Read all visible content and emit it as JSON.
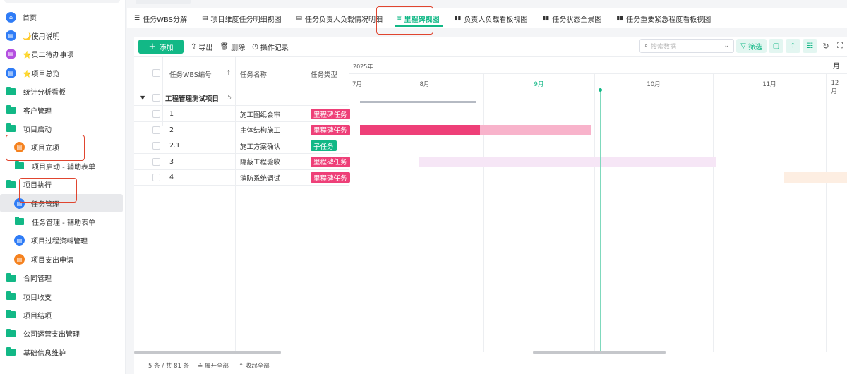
{
  "sidebar": {
    "items": [
      {
        "label": "首页",
        "icon": "home-icon",
        "kind": "circle",
        "color": "#2f7cf6"
      },
      {
        "label": "🌙使用说明",
        "icon": "document-icon",
        "kind": "circle",
        "color": "#2f7cf6"
      },
      {
        "label": "⭐员工待办事项",
        "icon": "chat-icon",
        "kind": "circle",
        "color": "#b44fe0"
      },
      {
        "label": "⭐项目总览",
        "icon": "document-icon",
        "kind": "circle",
        "color": "#2f7cf6"
      },
      {
        "label": "统计分析看板",
        "icon": "folder-icon",
        "kind": "folder"
      },
      {
        "label": "客户管理",
        "icon": "folder-icon",
        "kind": "folder"
      },
      {
        "label": "项目启动",
        "icon": "folder-open-icon",
        "kind": "folder"
      },
      {
        "label": "项目立项",
        "icon": "form-icon",
        "kind": "circle",
        "color": "#f5821f",
        "sub": true
      },
      {
        "label": "项目启动 - 辅助表单",
        "icon": "folder-icon",
        "kind": "folder",
        "sub": true
      },
      {
        "label": "项目执行",
        "icon": "folder-open-icon",
        "kind": "folder"
      },
      {
        "label": "任务管理",
        "icon": "document-icon",
        "kind": "circle",
        "color": "#2f7cf6",
        "sub": true,
        "active": true
      },
      {
        "label": "任务管理 - 辅助表单",
        "icon": "folder-icon",
        "kind": "folder",
        "sub": true
      },
      {
        "label": "项目过程资料管理",
        "icon": "document-icon",
        "kind": "circle",
        "color": "#2f7cf6",
        "sub": true
      },
      {
        "label": "项目支出申请",
        "icon": "form-icon",
        "kind": "circle",
        "color": "#f5821f",
        "sub": true
      },
      {
        "label": "合同管理",
        "icon": "folder-icon",
        "kind": "folder"
      },
      {
        "label": "项目收支",
        "icon": "folder-icon",
        "kind": "folder"
      },
      {
        "label": "项目结项",
        "icon": "folder-icon",
        "kind": "folder"
      },
      {
        "label": "公司运营支出管理",
        "icon": "folder-icon",
        "kind": "folder"
      },
      {
        "label": "基础信息维护",
        "icon": "folder-icon",
        "kind": "folder"
      }
    ]
  },
  "tabs": [
    {
      "label": "任务WBS分解",
      "icon": "☰"
    },
    {
      "label": "项目维度任务明细视图",
      "icon": "▤"
    },
    {
      "label": "任务负责人负载情况明细",
      "icon": "▤"
    },
    {
      "label": "里程碑视图",
      "icon": "⩸",
      "active": true
    },
    {
      "label": "负责人负载看板视图",
      "icon": "▮▮"
    },
    {
      "label": "任务状态全景图",
      "icon": "▮▮"
    },
    {
      "label": "任务重要紧急程度看板视图",
      "icon": "▮▮"
    }
  ],
  "toolbar": {
    "add": "添加",
    "export": "导出",
    "delete": "删除",
    "log": "操作记录",
    "search_placeholder": "搜索数据",
    "filter": "筛选",
    "scale": "月"
  },
  "table": {
    "headers": {
      "wbs": "任务WBS编号",
      "name": "任务名称",
      "type": "任务类型"
    },
    "group": {
      "name": "工程管理测试项目",
      "count": "5"
    },
    "rows": [
      {
        "wbs": "1",
        "name": "施工图纸会审",
        "type": "里程碑任务",
        "type_color": "#ee3f78"
      },
      {
        "wbs": "2",
        "name": "主体结构施工",
        "type": "里程碑任务",
        "type_color": "#ee3f78"
      },
      {
        "wbs": "2.1",
        "name": "施工方案确认",
        "type": "子任务",
        "type_color": "#12b886"
      },
      {
        "wbs": "3",
        "name": "隐蔽工程验收",
        "type": "里程碑任务",
        "type_color": "#ee3f78"
      },
      {
        "wbs": "4",
        "name": "消防系统调试",
        "type": "里程碑任务",
        "type_color": "#ee3f78"
      }
    ]
  },
  "gantt": {
    "year": "2025年",
    "months": [
      "7月",
      "8月",
      "9月",
      "10月",
      "11月",
      "12月"
    ],
    "current_month": "9月",
    "bars": [
      {
        "row": "group",
        "start": [
          7,
          25
        ],
        "end": [
          8,
          30
        ],
        "color": "#b5bac3"
      },
      {
        "row": 1,
        "start": [
          7,
          25
        ],
        "end": [
          8,
          31
        ],
        "color": "#ee3f78"
      },
      {
        "row": 1,
        "start": [
          8,
          31
        ],
        "end": [
          9,
          30
        ],
        "color": "#f8b3cb"
      },
      {
        "row": 3,
        "start": [
          8,
          15
        ],
        "end": [
          11,
          2
        ],
        "color": "#f6e6f6"
      },
      {
        "row": 4,
        "start": [
          11,
          20
        ],
        "end": [
          12,
          31
        ],
        "color": "#fdeee2"
      }
    ]
  },
  "footer": {
    "count": "5 条 / 共 81 条",
    "expand": "展开全部",
    "collapse": "收起全部"
  }
}
